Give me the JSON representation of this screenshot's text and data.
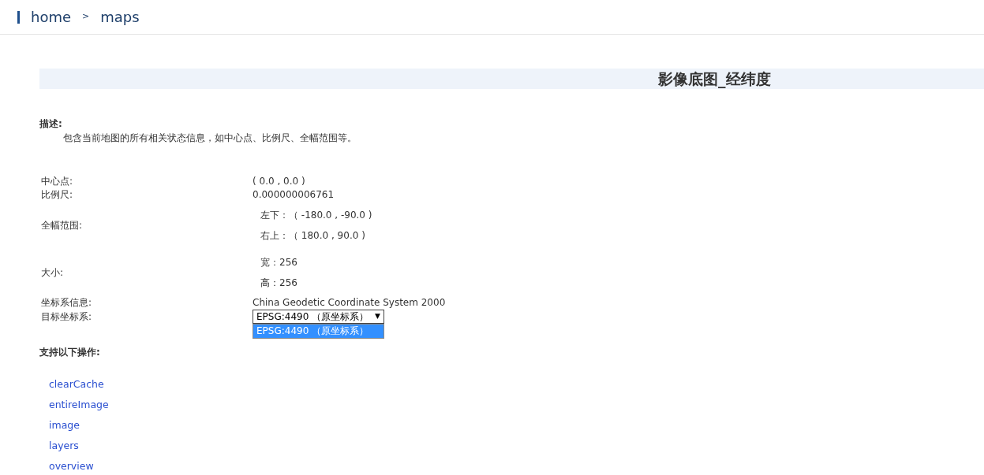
{
  "breadcrumb": {
    "items": [
      "home",
      "maps"
    ],
    "separator": ">"
  },
  "title": "影像底图_经纬度",
  "description": {
    "label": "描述:",
    "text": "包含当前地图的所有相关状态信息，如中心点、比例尺、全幅范围等。"
  },
  "properties": [
    {
      "kind": "text",
      "label": "中心点:",
      "value": "( 0.0 , 0.0 )"
    },
    {
      "kind": "text",
      "label": "比例尺:",
      "value": "0.000000006761"
    },
    {
      "kind": "pairs",
      "label": "全幅范围:",
      "values": [
        "左下：（ -180.0 , -90.0 )",
        "右上：（ 180.0 , 90.0 )"
      ]
    },
    {
      "kind": "pairs",
      "label": "大小:",
      "values": [
        "宽：256",
        "高：256"
      ]
    },
    {
      "kind": "text",
      "label": "坐标系信息:",
      "value": "China Geodetic Coordinate System 2000"
    },
    {
      "kind": "select",
      "label": "目标坐标系:",
      "value": "EPSG:4490 （原坐标系）",
      "arrow": "▼",
      "expanded": true,
      "options": [
        {
          "label": "EPSG:4490 （原坐标系）",
          "selected": true
        }
      ]
    }
  ],
  "operations_label": "支持以下操作:",
  "operations": [
    "clearCache",
    "entireImage",
    "image",
    "layers",
    "overview"
  ]
}
